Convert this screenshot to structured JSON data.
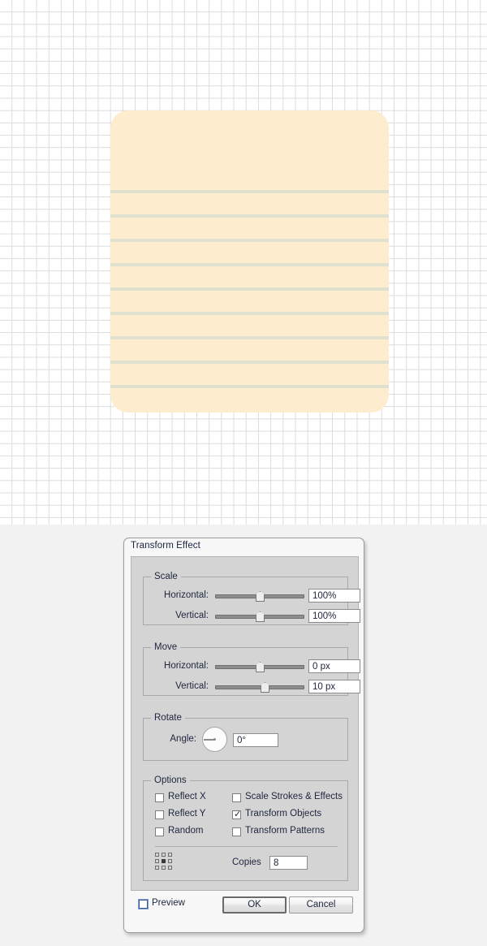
{
  "canvas": {
    "grid_color": "#dcdcdc",
    "background": "#ffffff",
    "artwork": {
      "name": "notepad-card",
      "fill": "#fdeccd",
      "line_color": "#dfe0ce",
      "line_count": 9,
      "line_spacing_px": 30
    }
  },
  "dialog": {
    "title": "Transform Effect",
    "scale": {
      "legend": "Scale",
      "horizontal_label": "Horizontal:",
      "horizontal_value": "100%",
      "vertical_label": "Vertical:",
      "vertical_value": "100%"
    },
    "move": {
      "legend": "Move",
      "horizontal_label": "Horizontal:",
      "horizontal_value": "0 px",
      "vertical_label": "Vertical:",
      "vertical_value": "10 px"
    },
    "rotate": {
      "legend": "Rotate",
      "angle_label": "Angle:",
      "angle_value": "0°"
    },
    "options": {
      "legend": "Options",
      "reflect_x": "Reflect X",
      "reflect_y": "Reflect Y",
      "random": "Random",
      "scale_strokes": "Scale Strokes & Effects",
      "transform_objects": "Transform Objects",
      "transform_patterns": "Transform Patterns",
      "transform_objects_checked": "✓",
      "copies_label": "Copies",
      "copies_value": "8"
    },
    "footer": {
      "preview_label": "Preview",
      "ok_label": "OK",
      "cancel_label": "Cancel"
    }
  }
}
